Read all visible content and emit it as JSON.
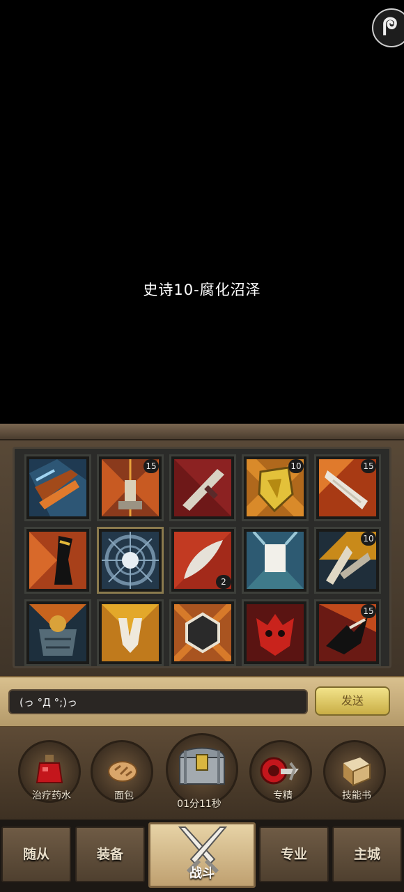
{
  "stage": {
    "title": "史诗10-腐化沼泽"
  },
  "inventory": {
    "slots": [
      {
        "icon": "dual-blade-skill-icon",
        "count": ""
      },
      {
        "icon": "hammer-strike-skill-icon",
        "count": "15"
      },
      {
        "icon": "sword-shield-skill-icon",
        "count": ""
      },
      {
        "icon": "golden-shield-skill-icon",
        "count": "10"
      },
      {
        "icon": "slash-skill-icon",
        "count": "15"
      },
      {
        "icon": "dark-banner-skill-icon",
        "count": ""
      },
      {
        "icon": "radiant-orb-skill-icon",
        "count": ""
      },
      {
        "icon": "blade-skill-icon",
        "count": "2"
      },
      {
        "icon": "white-banner-skill-icon",
        "count": ""
      },
      {
        "icon": "storm-skill-icon",
        "count": "10"
      },
      {
        "icon": "cauldron-skill-icon",
        "count": ""
      },
      {
        "icon": "claw-skill-icon",
        "count": ""
      },
      {
        "icon": "hexagon-shield-skill-icon",
        "count": ""
      },
      {
        "icon": "demon-mask-skill-icon",
        "count": ""
      },
      {
        "icon": "shadow-strike-skill-icon",
        "count": "15"
      }
    ]
  },
  "chat": {
    "input_value": "(っ °Д °;)っ",
    "send_label": "发送"
  },
  "actions": [
    {
      "icon": "health-potion-icon",
      "label": "治疗药水"
    },
    {
      "icon": "bread-icon",
      "label": "面包"
    },
    {
      "icon": "treasure-chest-icon",
      "label": "01分11秒"
    },
    {
      "icon": "specialization-axe-icon",
      "label": "专精"
    },
    {
      "icon": "skill-book-icon",
      "label": "技能书"
    }
  ],
  "tabs": [
    {
      "label": "随从"
    },
    {
      "label": "装备"
    },
    {
      "label": "战斗",
      "icon": "crossed-swords-icon"
    },
    {
      "label": "专业"
    },
    {
      "label": "主城"
    }
  ],
  "colors": {
    "panel": "#4f4030",
    "gold_button": "#e3cf6e",
    "dark_slot": "#1a1a18"
  }
}
